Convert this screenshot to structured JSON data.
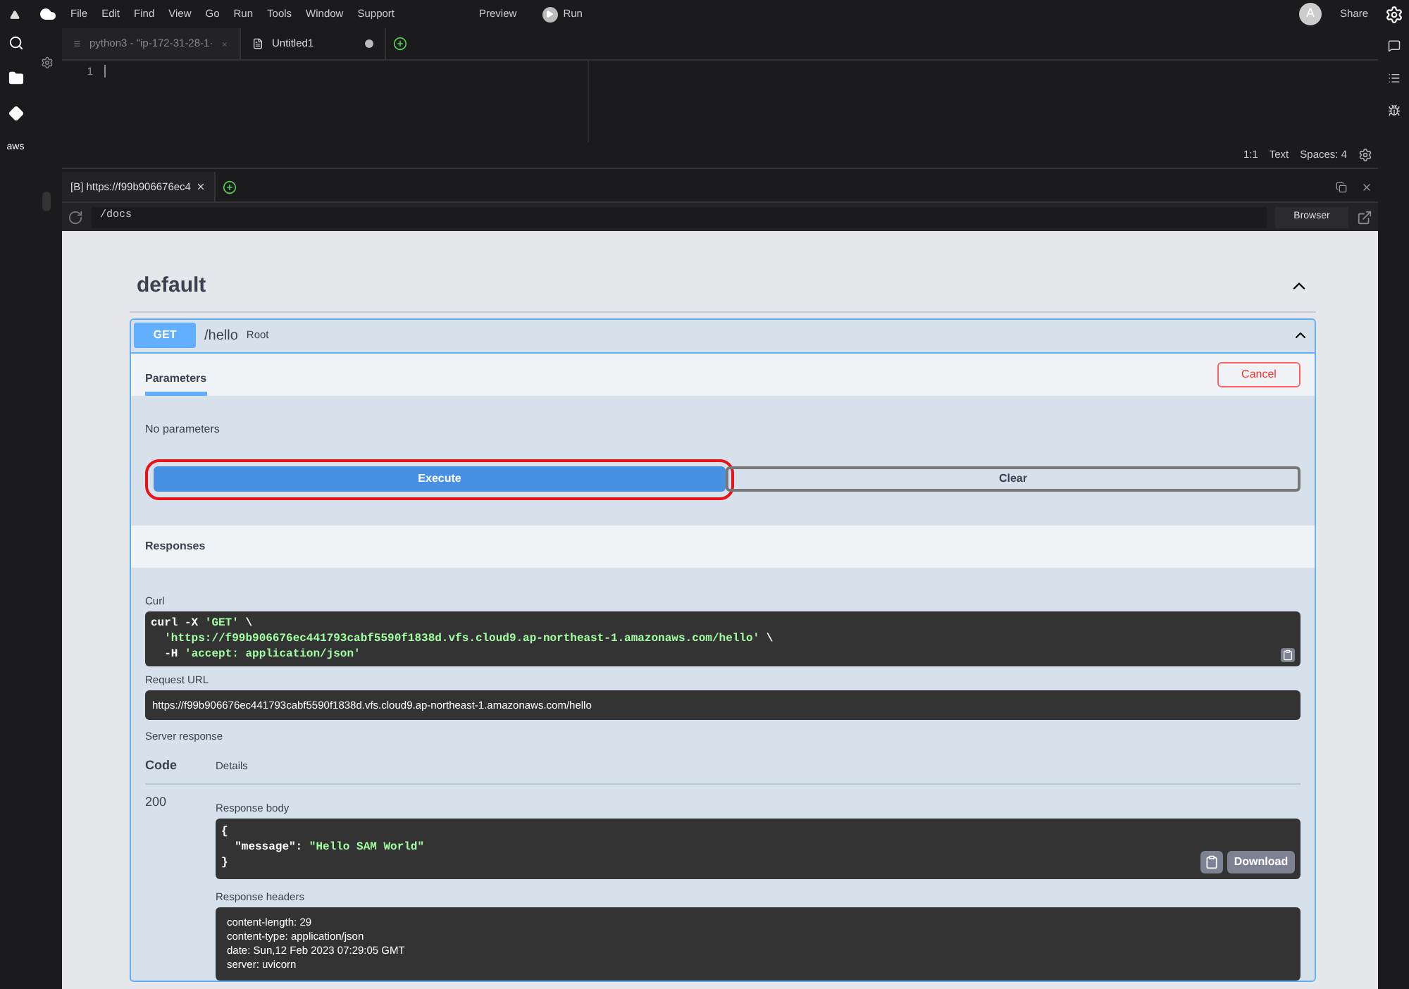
{
  "menubar": {
    "menus": [
      "File",
      "Edit",
      "Find",
      "View",
      "Go",
      "Run",
      "Tools",
      "Window",
      "Support"
    ],
    "preview": "Preview",
    "run": "Run",
    "avatar": "A",
    "share": "Share"
  },
  "left_sidebar": {
    "aws_label": "aws"
  },
  "editor_tabs": [
    {
      "kind": "terminal",
      "label": "python3 - \"ip-172-31-28-1·",
      "selected": false,
      "modified": false
    },
    {
      "kind": "file",
      "label": "Untitled1",
      "selected": true,
      "modified": true
    }
  ],
  "editor": {
    "line_numbers": [
      "1"
    ],
    "status": [
      "1:1",
      "Text",
      "Spaces: 4"
    ]
  },
  "browser": {
    "tabs": [
      {
        "label": "[B] https://f99b906676ec4",
        "selected": true
      }
    ],
    "address": "/docs",
    "mode": "Browser"
  },
  "swagger": {
    "section": {
      "title": "default",
      "expanded": true
    },
    "operation": {
      "method": "GET",
      "path": "/hello",
      "summary": "Root",
      "expanded": true
    },
    "parameters_tab": "Parameters",
    "cancel": "Cancel",
    "no_params": "No parameters",
    "execute": {
      "label": "Execute",
      "highlighted": true
    },
    "clear": "Clear",
    "responses_title": "Responses",
    "curl_label": "Curl",
    "curl": [
      [
        {
          "kind": "plain",
          "text": "curl -X "
        },
        {
          "kind": "string",
          "text": "'GET'"
        },
        {
          "kind": "plain",
          "text": " \\"
        }
      ],
      [
        {
          "kind": "string",
          "text": "  'https://f99b906676ec441793cabf5590f1838d.vfs.cloud9.ap-northeast-1.amazonaws.com/hello'"
        },
        {
          "kind": "plain",
          "text": " \\"
        }
      ],
      [
        {
          "kind": "plain",
          "text": "  -H "
        },
        {
          "kind": "string",
          "text": "'accept: application/json'"
        }
      ]
    ],
    "request_url_label": "Request URL",
    "request_url": "https://f99b906676ec441793cabf5590f1838d.vfs.cloud9.ap-northeast-1.amazonaws.com/hello",
    "server_response_label": "Server response",
    "code_header": "Code",
    "details_header": "Details",
    "response_code": "200",
    "body_label": "Response body",
    "body": [
      [
        {
          "kind": "plain",
          "text": "{"
        }
      ],
      [
        {
          "kind": "plain",
          "text": "  \"message\": "
        },
        {
          "kind": "string",
          "text": "\"Hello SAM World\""
        }
      ],
      [
        {
          "kind": "plain",
          "text": "}"
        }
      ]
    ],
    "download": "Download",
    "headers_label": "Response headers",
    "headers": [
      "content-length: 29",
      "content-type: application/json",
      "date: Sun,12 Feb 2023 07:29:05 GMT",
      "server: uvicorn"
    ]
  }
}
